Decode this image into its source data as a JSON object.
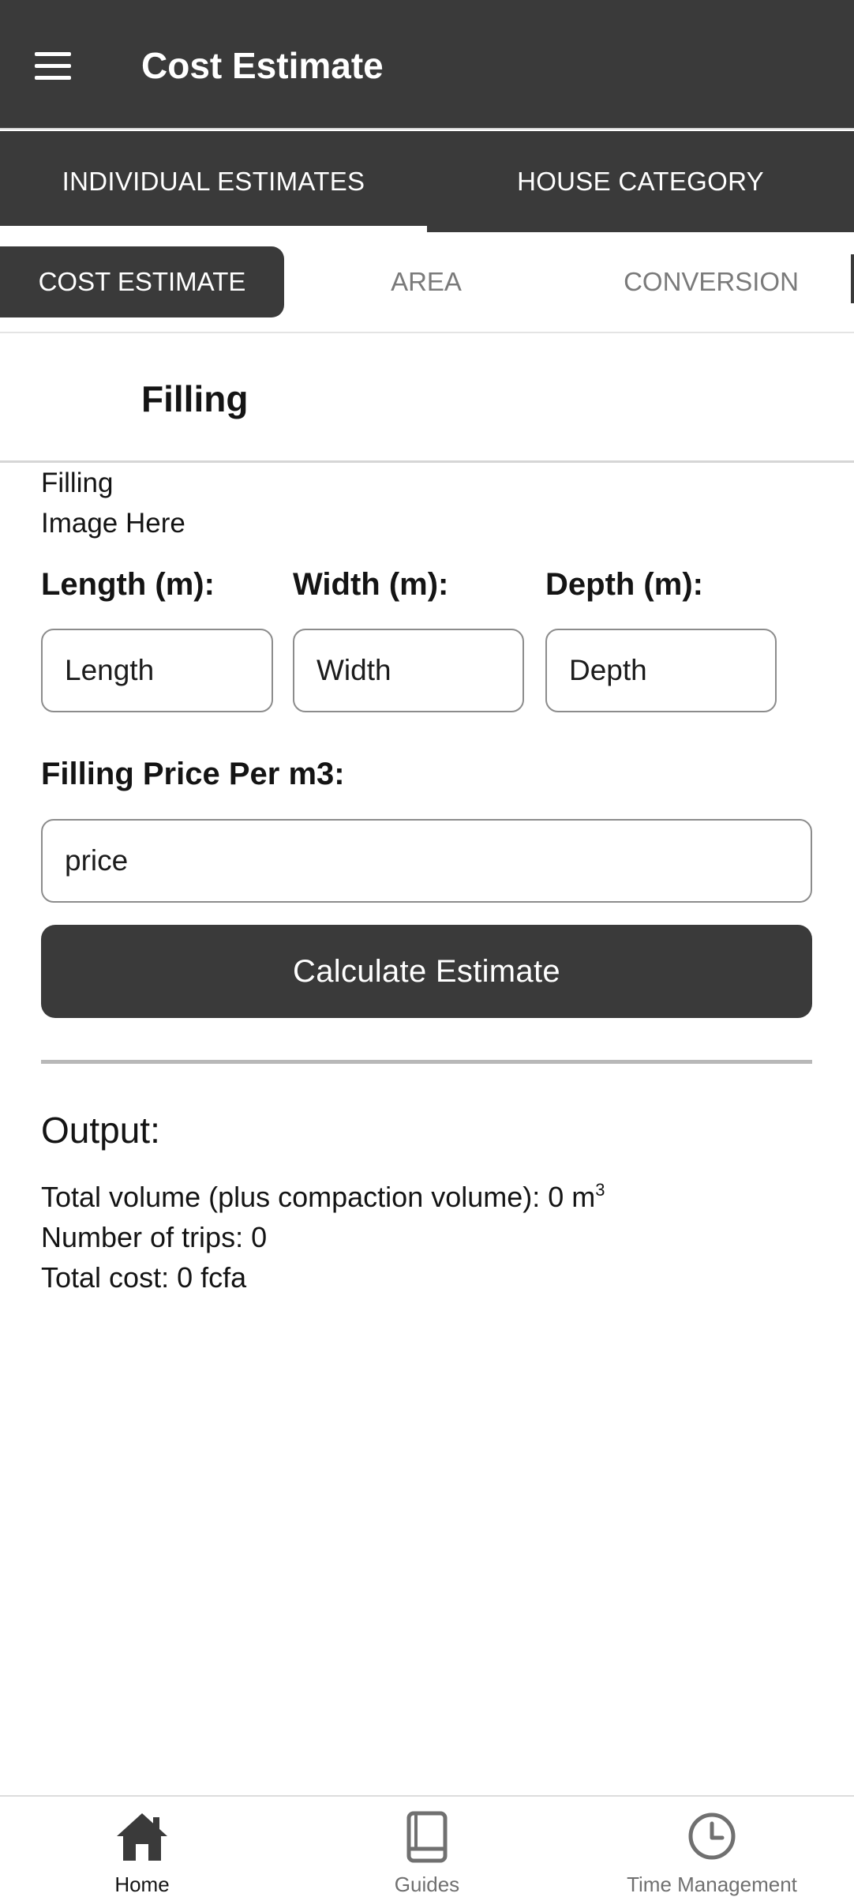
{
  "appbar": {
    "title": "Cost Estimate"
  },
  "tabs": [
    {
      "label": "INDIVIDUAL ESTIMATES",
      "active": true
    },
    {
      "label": "HOUSE CATEGORY",
      "active": false
    }
  ],
  "subtabs": [
    {
      "label": "COST ESTIMATE",
      "active": true
    },
    {
      "label": "AREA",
      "active": false
    },
    {
      "label": "CONVERSION",
      "active": false
    }
  ],
  "section": {
    "title": "Filling"
  },
  "image_placeholder": {
    "line1": "Filling",
    "line2": "Image Here"
  },
  "form": {
    "length_label": "Length (m):",
    "length_placeholder": "Length",
    "width_label": "Width (m):",
    "width_placeholder": "Width",
    "depth_label": "Depth (m):",
    "depth_placeholder": "Depth",
    "price_label": "Filling Price Per m3:",
    "price_placeholder": "price",
    "calculate_label": "Calculate Estimate"
  },
  "output": {
    "title": "Output:",
    "volume_text": "Total volume (plus compaction volume): 0 m",
    "volume_sup": "3",
    "trips_text": "Number of trips: 0",
    "cost_text": "Total cost: 0 fcfa"
  },
  "bottom_nav": [
    {
      "label": "Home",
      "icon": "home-icon",
      "active": true
    },
    {
      "label": "Guides",
      "icon": "book-icon",
      "active": false
    },
    {
      "label": "Time Management",
      "icon": "clock-icon",
      "active": false
    }
  ],
  "colors": {
    "primary": "#3a3a3a",
    "on_primary": "#ffffff",
    "inactive_text": "#7a7a7a"
  }
}
